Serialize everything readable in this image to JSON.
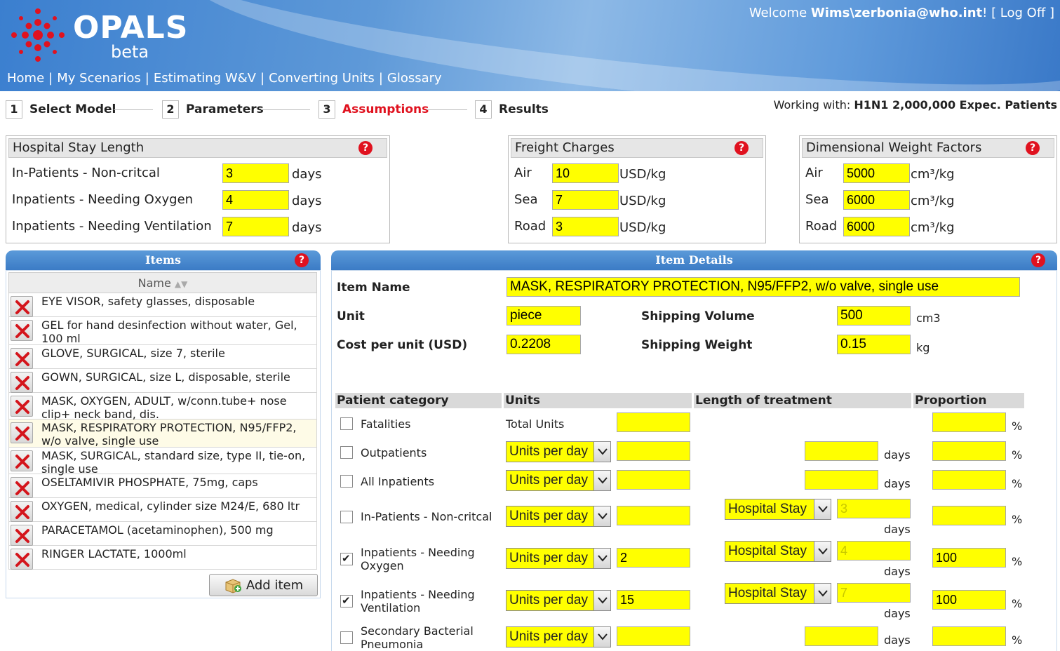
{
  "header": {
    "logo_text": "OPALS",
    "logo_sub": "beta",
    "welcome_prefix": "Welcome ",
    "user": "Wims\\zerbonia@who.int",
    "welcome_suffix": "! ",
    "logoff": "[ Log Off ]",
    "nav": [
      "Home",
      "My Scenarios",
      "Estimating W&V",
      "Converting Units",
      "Glossary"
    ]
  },
  "steps": [
    {
      "num": "1",
      "label": "Select Model"
    },
    {
      "num": "2",
      "label": "Parameters"
    },
    {
      "num": "3",
      "label": "Assumptions"
    },
    {
      "num": "4",
      "label": "Results"
    }
  ],
  "working": {
    "prefix": "Working with: ",
    "scenario": "H1N1 2,000,000 Expec. Patients"
  },
  "hospital_stay": {
    "title": "Hospital Stay Length",
    "rows": [
      {
        "label": "In-Patients - Non-critcal",
        "value": "3",
        "unit": "days"
      },
      {
        "label": "Inpatients - Needing Oxygen",
        "value": "4",
        "unit": "days"
      },
      {
        "label": "Inpatients - Needing Ventilation",
        "value": "7",
        "unit": "days"
      }
    ]
  },
  "freight": {
    "title": "Freight Charges",
    "rows": [
      {
        "label": "Air",
        "value": "10",
        "unit": "USD/kg"
      },
      {
        "label": "Sea",
        "value": "7",
        "unit": "USD/kg"
      },
      {
        "label": "Road",
        "value": "3",
        "unit": "USD/kg"
      }
    ]
  },
  "dimensional": {
    "title": "Dimensional Weight Factors",
    "rows": [
      {
        "label": "Air",
        "value": "5000",
        "unit": "cm³/kg"
      },
      {
        "label": "Sea",
        "value": "6000",
        "unit": "cm³/kg"
      },
      {
        "label": "Road",
        "value": "6000",
        "unit": "cm³/kg"
      }
    ]
  },
  "items_panel": {
    "title": "Items",
    "column": "Name",
    "items": [
      "EYE VISOR, safety glasses, disposable",
      "GEL for hand desinfection without water, Gel, 100 ml",
      "GLOVE, SURGICAL, size 7, sterile",
      "GOWN, SURGICAL, size L, disposable, sterile",
      "MASK, OXYGEN, ADULT, w/conn.tube+ nose clip+ neck band, dis.",
      "MASK, RESPIRATORY PROTECTION, N95/FFP2, w/o valve, single use",
      "MASK, SURGICAL, standard size, type II, tie-on, single use",
      "OSELTAMIVIR PHOSPHATE, 75mg, caps",
      "OXYGEN, medical, cylinder size M24/E, 680 ltr",
      "PARACETAMOL (acetaminophen), 500 mg",
      "RINGER LACTATE, 1000ml"
    ],
    "selected_index": 5,
    "add_label": "Add item"
  },
  "details": {
    "title": "Item Details",
    "item_name_label": "Item Name",
    "item_name": "MASK, RESPIRATORY PROTECTION, N95/FFP2, w/o valve, single use",
    "unit_label": "Unit",
    "unit": "piece",
    "cost_label": "Cost per unit (USD)",
    "cost": "0.2208",
    "ship_vol_label": "Shipping Volume",
    "ship_vol": "500",
    "ship_vol_unit": "cm3",
    "ship_wt_label": "Shipping Weight",
    "ship_wt": "0.15",
    "ship_wt_unit": "kg",
    "columns": [
      "Patient category",
      "Units",
      "Length of treatment",
      "Proportion"
    ],
    "total_units_label": "Total Units",
    "units_option": "Units per day",
    "stay_option": "Hospital Stay",
    "days": "days",
    "pct": "%",
    "categories": [
      {
        "label": "Fatalities",
        "checked": false,
        "units": "",
        "length": "",
        "proportion": ""
      },
      {
        "label": "Outpatients",
        "checked": false,
        "units": "",
        "length": "",
        "proportion": ""
      },
      {
        "label": "All Inpatients",
        "checked": false,
        "units": "",
        "length": "",
        "proportion": ""
      },
      {
        "label": "In-Patients - Non-critcal",
        "checked": false,
        "units": "",
        "length": "3",
        "proportion": ""
      },
      {
        "label": "Inpatients - Needing Oxygen",
        "checked": true,
        "units": "2",
        "length": "4",
        "proportion": "100"
      },
      {
        "label": "Inpatients - Needing Ventilation",
        "checked": true,
        "units": "15",
        "length": "7",
        "proportion": "100"
      },
      {
        "label": "Secondary Bacterial Pneumonia",
        "checked": false,
        "units": "",
        "length": "",
        "proportion": ""
      }
    ]
  },
  "colors": {
    "accent": "#3b7bc5",
    "field": "#ffff00",
    "alert": "#e0121f"
  }
}
